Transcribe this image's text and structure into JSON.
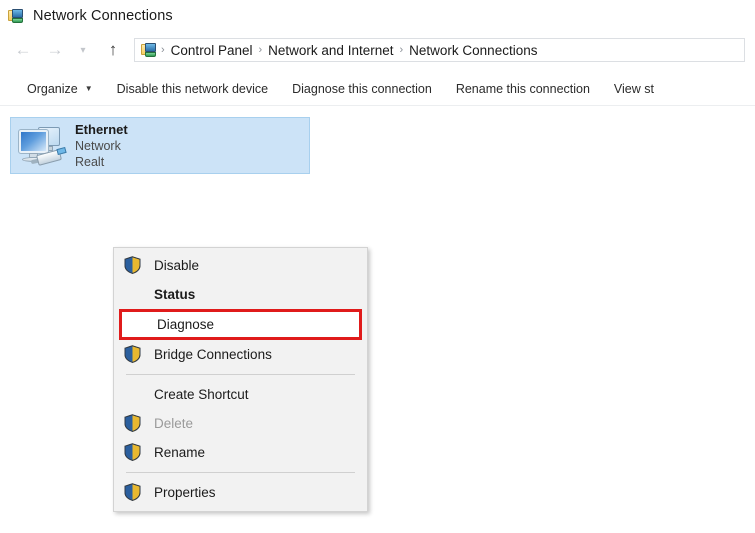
{
  "window": {
    "title": "Network Connections",
    "icon": "network-connections-icon"
  },
  "address_bar": {
    "back_icon": "←",
    "forward_icon": "→",
    "recent_icon": "▾",
    "up_icon": "↑",
    "path_icon": "network-connections-icon",
    "separator": "›",
    "crumbs": [
      "Control Panel",
      "Network and Internet",
      "Network Connections"
    ]
  },
  "toolbar": {
    "items": [
      {
        "label": "Organize",
        "caret": "▼"
      },
      {
        "label": "Disable this network device",
        "caret": ""
      },
      {
        "label": "Diagnose this connection",
        "caret": ""
      },
      {
        "label": "Rename this connection",
        "caret": ""
      },
      {
        "label": "View st",
        "caret": ""
      }
    ]
  },
  "connections": [
    {
      "name": "Ethernet",
      "network": "Network",
      "adapter": "Realt",
      "icon": "ethernet-adapter-icon",
      "selected": true
    }
  ],
  "context_menu": {
    "items": [
      {
        "label": "Disable",
        "icon": "shield-icon",
        "bold": false,
        "disabled": false,
        "highlighted": false
      },
      {
        "label": "Status",
        "icon": "",
        "bold": true,
        "disabled": false,
        "highlighted": false
      },
      {
        "label": "Diagnose",
        "icon": "",
        "bold": false,
        "disabled": false,
        "highlighted": true
      },
      {
        "label": "Bridge Connections",
        "icon": "shield-icon",
        "bold": false,
        "disabled": false,
        "highlighted": false
      },
      {
        "label": "__separator__",
        "icon": "",
        "bold": false,
        "disabled": false,
        "highlighted": false
      },
      {
        "label": "Create Shortcut",
        "icon": "",
        "bold": false,
        "disabled": false,
        "highlighted": false
      },
      {
        "label": "Delete",
        "icon": "shield-icon",
        "bold": false,
        "disabled": true,
        "highlighted": false
      },
      {
        "label": "Rename",
        "icon": "shield-icon",
        "bold": false,
        "disabled": false,
        "highlighted": false
      },
      {
        "label": "__separator__",
        "icon": "",
        "bold": false,
        "disabled": false,
        "highlighted": false
      },
      {
        "label": "Properties",
        "icon": "shield-icon",
        "bold": false,
        "disabled": false,
        "highlighted": false
      }
    ]
  },
  "colors": {
    "selection_background": "#cce3f7",
    "selection_border": "#a8d0ee",
    "highlight_outline": "#e01b1b",
    "menu_background": "#f2f2f2",
    "shield_blue": "#2b5f9e",
    "shield_gold": "#e8b830"
  }
}
